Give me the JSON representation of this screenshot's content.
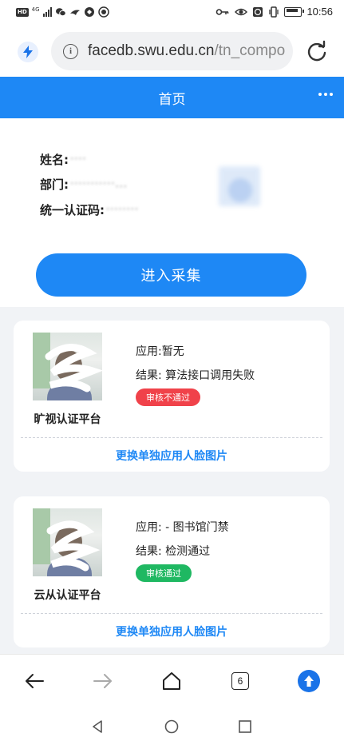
{
  "status_bar": {
    "hd": "HD",
    "network": "4G",
    "time": "10:56"
  },
  "address_bar": {
    "url_host": "facedb.swu.edu.cn",
    "url_path": "/tn_compo"
  },
  "header": {
    "title": "首页"
  },
  "user": {
    "name_label": "姓名:",
    "name_value": "····",
    "dept_label": "部门:",
    "dept_value": "···········...",
    "id_label": "统一认证码:",
    "id_value": "········"
  },
  "enter_button": "进入采集",
  "cards": [
    {
      "platform": "旷视认证平台",
      "app": "应用:暂无",
      "result": "结果: 算法接口调用失败",
      "status": "审核不通过",
      "status_color": "#f0424a",
      "action": "更换单独应用人脸图片"
    },
    {
      "platform": "云从认证平台",
      "app": "应用: - 图书馆门禁",
      "result": "结果: 检测通过",
      "status": "审核通过",
      "status_color": "#1fb862",
      "action": "更换单独应用人脸图片"
    }
  ],
  "toolbar": {
    "tab_count": "6"
  },
  "colors": {
    "primary": "#1e88f5",
    "page_bg": "#f1f3f6"
  }
}
